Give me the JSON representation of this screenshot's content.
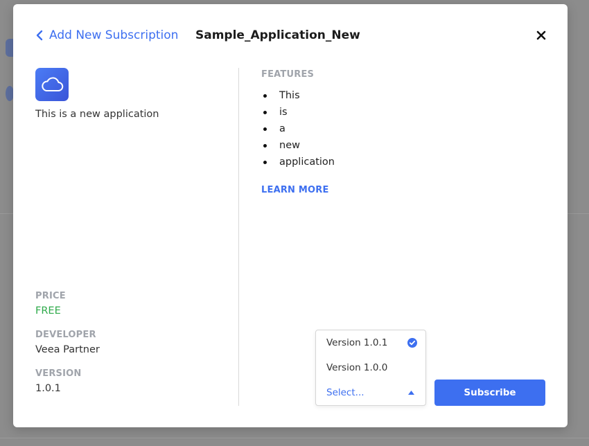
{
  "header": {
    "back_label": "Add New Subscription",
    "app_title": "Sample_Application_New"
  },
  "app": {
    "icon": "cloud-icon",
    "description": "This is a new application"
  },
  "details": {
    "price_label": "PRICE",
    "price_value": "FREE",
    "developer_label": "DEVELOPER",
    "developer_value": "Veea Partner",
    "version_label": "VERSION",
    "version_value": "1.0.1"
  },
  "features": {
    "label": "FEATURES",
    "items": [
      "This",
      "is",
      "a",
      "new",
      "application"
    ],
    "learn_more": "LEARN MORE"
  },
  "version_dropdown": {
    "options": [
      {
        "label": "Version 1.0.1",
        "selected": true
      },
      {
        "label": "Version 1.0.0",
        "selected": false
      }
    ],
    "placeholder": "Select..."
  },
  "actions": {
    "subscribe_label": "Subscribe"
  },
  "colors": {
    "accent": "#3d6ff0",
    "price_green": "#2eaa4a",
    "section_label_gray": "#a0a4ab"
  }
}
